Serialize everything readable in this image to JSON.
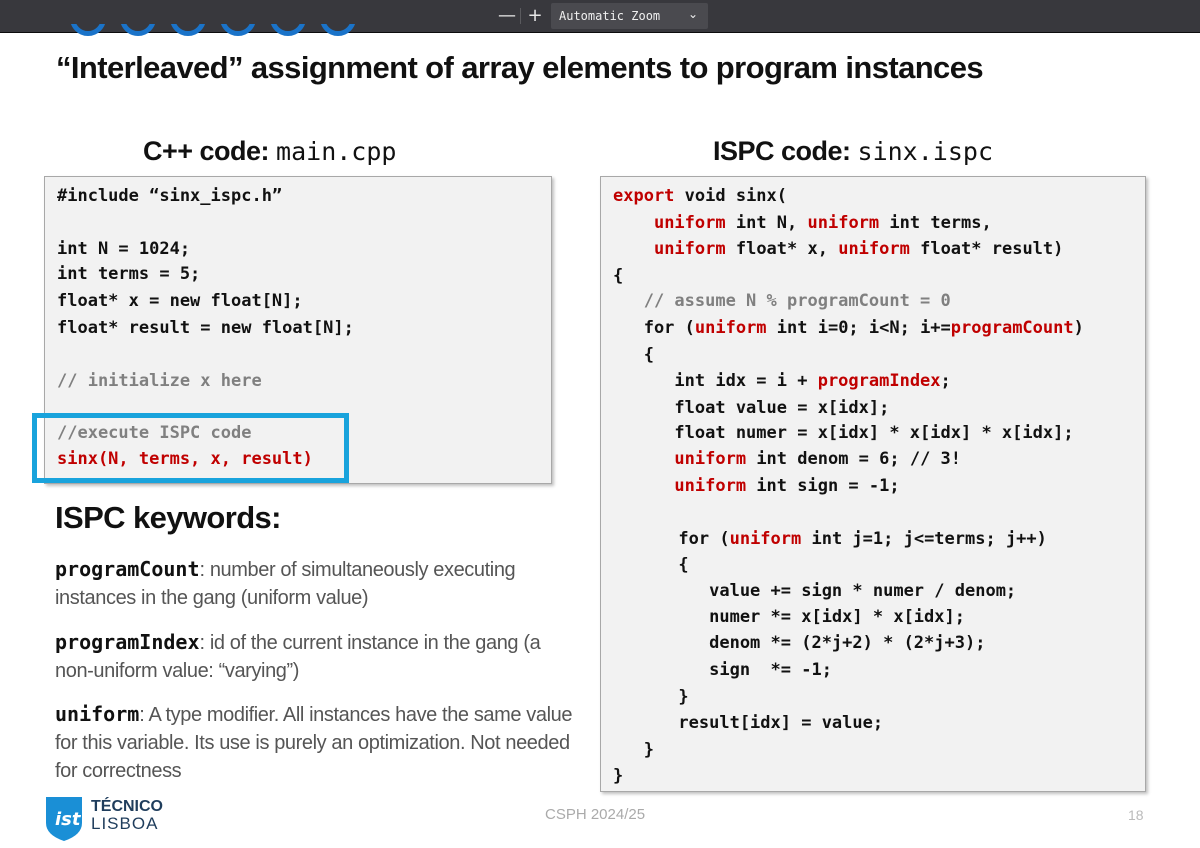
{
  "viewer": {
    "zoom_out_icon": "minus-icon",
    "zoom_in_icon": "plus-icon",
    "zoom_out": "—",
    "zoom_in": "+",
    "zoom_value": "Automatic Zoom",
    "zoom_caret": "⌄"
  },
  "slide": {
    "title": "“Interleaved” assignment of array elements to program instances",
    "cpp_panel": {
      "heading": "C++ code: ",
      "heading_file": "main.cpp",
      "lines": [
        "#include “sinx_ispc.h”",
        "",
        "int N = 1024;",
        "int terms = 5;",
        "float* x = new float[N];",
        "float* result = new float[N];",
        "",
        "// initialize x here",
        "",
        "//execute ISPC code",
        "sinx(N, terms, x, result)"
      ]
    },
    "ispc_panel": {
      "heading": "ISPC code: ",
      "heading_file": "sinx.ispc",
      "code": {
        "l0_a": "export",
        "l0_b": " void sinx(",
        "l1_a": "    ",
        "l1_b": "uniform",
        "l1_c": " int N, ",
        "l1_d": "uniform",
        "l1_e": " int terms,",
        "l2_a": "    ",
        "l2_b": "uniform",
        "l2_c": " float* x, ",
        "l2_d": "uniform",
        "l2_e": " float* result)",
        "l3": "{",
        "l4": "   // assume N % programCount = 0",
        "l5_a": "   for (",
        "l5_b": "uniform",
        "l5_c": " int i=0; i<N; i+=",
        "l5_d": "programCount",
        "l5_e": ")",
        "l6": "   {",
        "l7_a": "      int idx = i + ",
        "l7_b": "programIndex",
        "l7_c": ";",
        "l8": "      float value = x[idx];",
        "l9": "      float numer = x[idx] * x[idx] * x[idx];",
        "l10_a": "      ",
        "l10_b": "uniform",
        "l10_c": " int denom = 6; // 3!",
        "l11_a": "      ",
        "l11_b": "uniform",
        "l11_c": " int sign = -1;",
        "l13_a": "      for (",
        "l13_b": "uniform",
        "l13_c": " int j=1; j<=terms; j++)",
        "l14": "      {",
        "l15": "         value += sign * numer / denom;",
        "l16": "         numer *= x[idx] * x[idx];",
        "l17": "         denom *= (2*j+2) * (2*j+3);",
        "l18": "         sign  *= -1;",
        "l19": "      }",
        "l20": "      result[idx] = value;",
        "l21": "   }",
        "l22": "}"
      }
    },
    "keywords": {
      "heading": "ISPC keywords:",
      "items": [
        {
          "term": "programCount",
          "desc": ": number of simultaneously executing instances in the gang (uniform value)"
        },
        {
          "term": "programIndex",
          "desc": ": id of the current instance in the gang (a non-uniform value: “varying”)"
        },
        {
          "term": "uniform",
          "desc": ": A type modifier. All instances have the same value for this variable. Its use is purely an optimization. Not needed for correctness"
        }
      ]
    },
    "footer": {
      "logo_line1": "TÉCNICO",
      "logo_line2": "LISBOA",
      "course": "CSPH 2024/25",
      "page": "18"
    }
  },
  "colors": {
    "keyword": "#c00000",
    "comment": "#808080",
    "highlight": "#19a3dc",
    "toolbar": "#38383d"
  }
}
